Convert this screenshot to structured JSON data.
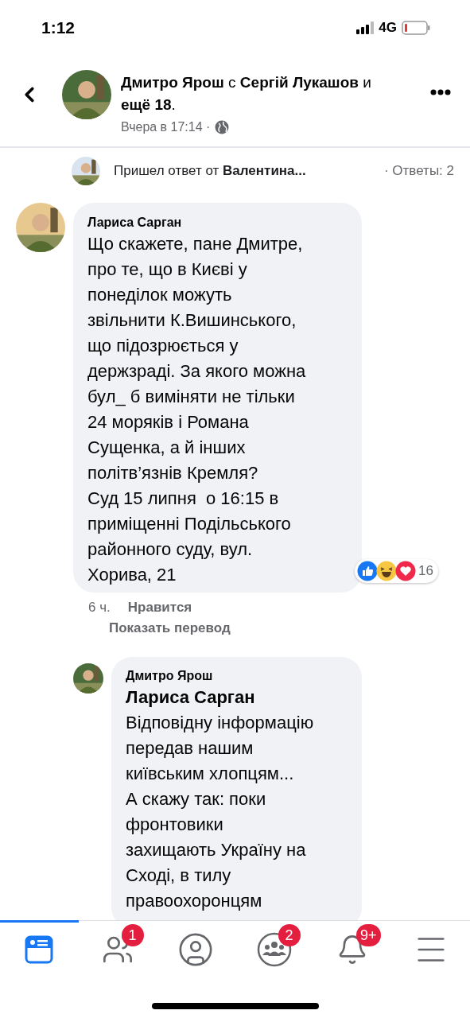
{
  "status_bar": {
    "time": "1:12",
    "network": "4G"
  },
  "header": {
    "title": "**Дмитро Ярош** с **Сергій Лукашов** и **ещё 18**.",
    "meta": "Вчера в 17:14 ·"
  },
  "reply_preview": {
    "text": "Пришел ответ от **Валентина...**",
    "count": "· Ответы: 2"
  },
  "comment": {
    "author": "Лариса Сарган",
    "text": "Що скажете, пане Дмитре,\nпро те, що в Києві у\nпонеділок можуть\nзвільнити К.Вишинського,\nщо підозрюється у\nдержзраді. За якого можна\nбул_ б виміняти не тільки\n24 моряків і Романа\nСущенка, а й інших\nполітв’язнів Кремля?\nСуд 15 липня  о 16:15 в\nприміщенні Подільського\nрайонного суду, вул.\nХорива, 21",
    "reaction_count": "16",
    "time": "6 ч.",
    "like": "Нравится",
    "translate": "Показать перевод"
  },
  "reply": {
    "author": "Дмитро Ярош",
    "mention": "Лариса Сарган",
    "text": "Відповідну інформацію\nпередав нашим\nкиївським хлопцям...\nА скажу так: поки\nфронтовики\nзахищають Україну на\nСході, в тилу\nправоохоронцям"
  },
  "tabs": [
    {
      "kind": "feed",
      "selected": true
    },
    {
      "kind": "friends",
      "selected": false,
      "badge": "1"
    },
    {
      "kind": "profile",
      "selected": false
    },
    {
      "kind": "groups",
      "selected": false,
      "badge": "2"
    },
    {
      "kind": "notifications",
      "selected": false,
      "badge": "9+"
    },
    {
      "kind": "menu",
      "selected": false
    }
  ]
}
